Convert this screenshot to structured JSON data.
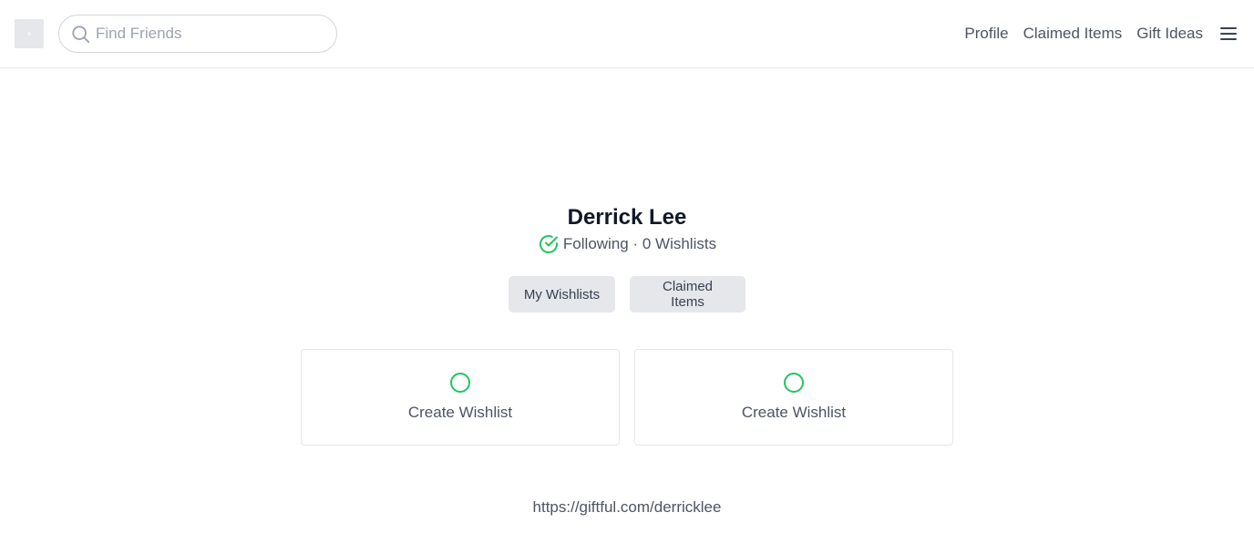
{
  "header": {
    "search_placeholder": "Find Friends",
    "nav": [
      "Profile",
      "Claimed Items",
      "Gift Ideas"
    ]
  },
  "profile": {
    "name": "Derrick Lee",
    "follow_status": "Following · 0 Wishlists",
    "url": "https://giftful.com/derricklee"
  },
  "tabs": [
    "My Wishlists",
    "Claimed Items"
  ],
  "cards": [
    "Create Wishlist",
    "Create Wishlist"
  ],
  "colors": {
    "accent": "#22c55e",
    "button_bg": "#e5e7eb",
    "border": "#e5e7eb",
    "muted_text": "#4b5563"
  },
  "icons": {
    "search": "search-icon",
    "menu": "hamburger-menu-icon",
    "following": "check-circle-icon",
    "create": "circle-icon"
  }
}
